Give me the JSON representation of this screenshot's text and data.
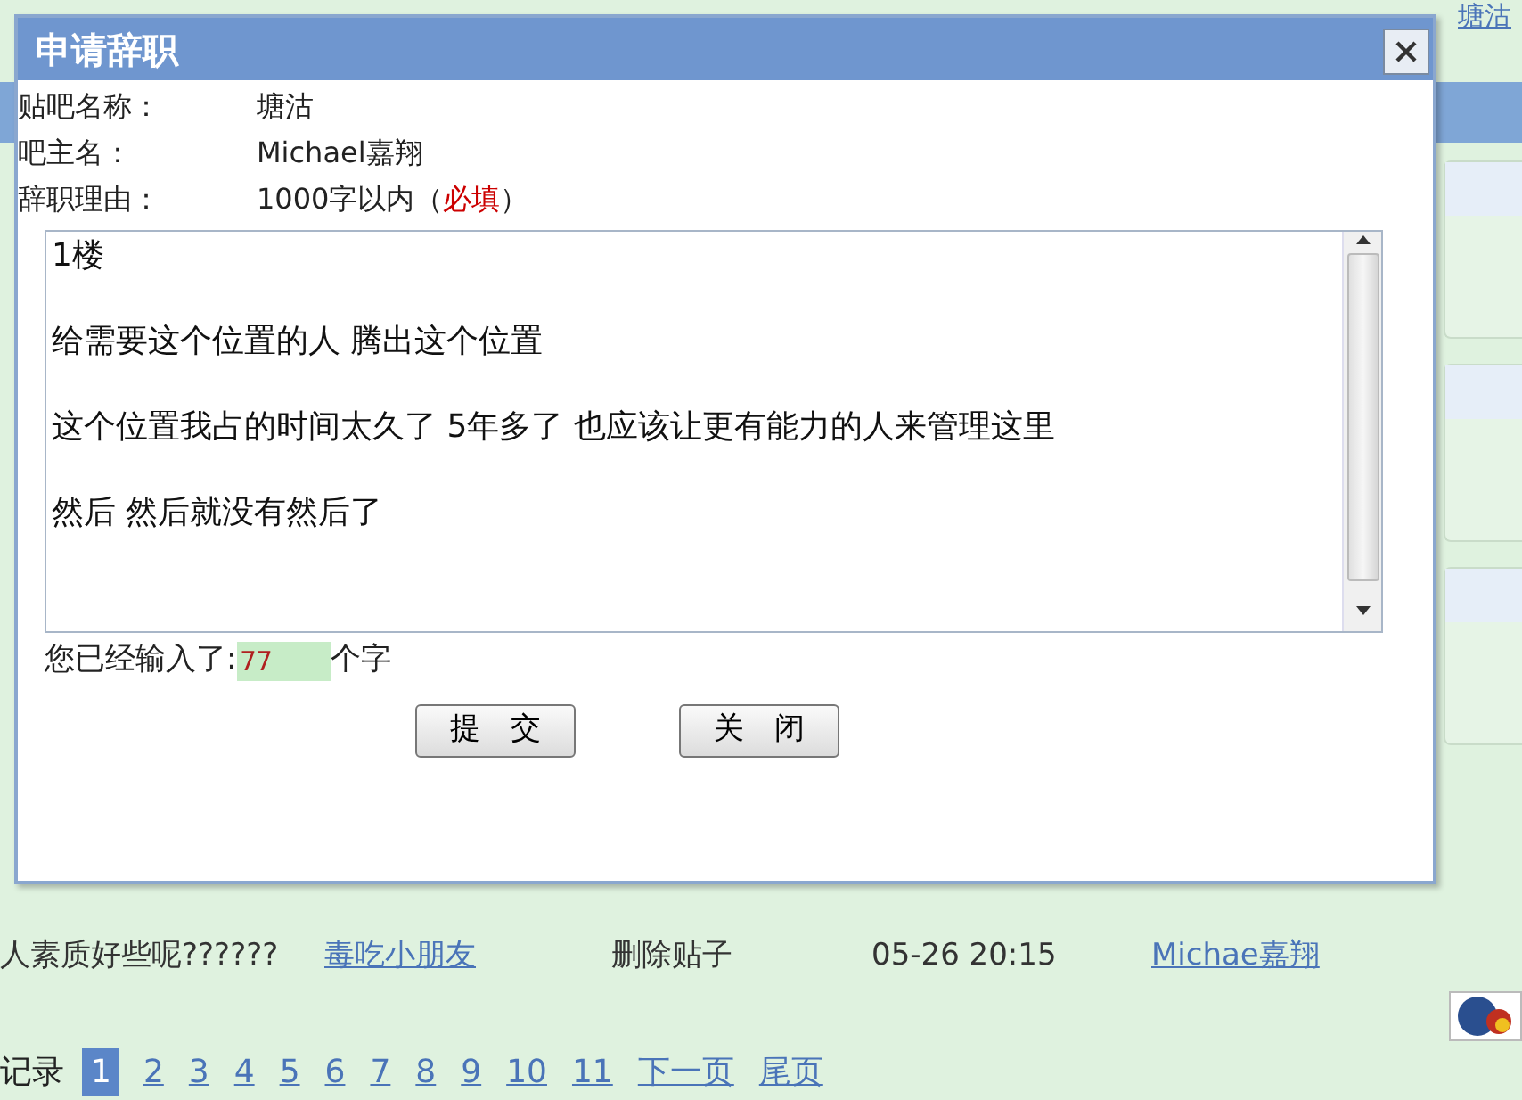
{
  "page": {
    "owner_link": "塘沽",
    "row": {
      "title": "人素质好些呢??????",
      "author": "毒吃小朋友",
      "action": "删除贴子",
      "time": "05-26 20:15",
      "operator": "Michae嘉翔"
    },
    "pagination": {
      "label": "记录",
      "pages": [
        {
          "label": "1",
          "selected": true
        },
        {
          "label": "2",
          "selected": false
        },
        {
          "label": "3",
          "selected": false
        },
        {
          "label": "4",
          "selected": false
        },
        {
          "label": "5",
          "selected": false
        },
        {
          "label": "6",
          "selected": false
        },
        {
          "label": "7",
          "selected": false
        },
        {
          "label": "8",
          "selected": false
        },
        {
          "label": "9",
          "selected": false
        },
        {
          "label": "10",
          "selected": false
        },
        {
          "label": "11",
          "selected": false
        }
      ],
      "next": "下一页",
      "last": "尾页"
    }
  },
  "dialog": {
    "title": "申请辞职",
    "fields": [
      {
        "label": "贴吧名称：",
        "value": "塘沽"
      },
      {
        "label": "吧主名：",
        "value": "Michael嘉翔"
      },
      {
        "label": "辞职理由：",
        "value": "1000字以内（",
        "required": "必填",
        "value_end": "）"
      }
    ],
    "reason_lines": [
      "1楼",
      "给需要这个位置的人 腾出这个位置",
      "这个位置我占的时间太久了 5年多了 也应该让更有能力的人来管理这里",
      "然后 然后就没有然后了"
    ],
    "counter": {
      "prefix": "您已经输入了:",
      "count": "77",
      "suffix": "个字"
    },
    "buttons": [
      "提　交",
      "关　闭"
    ]
  }
}
